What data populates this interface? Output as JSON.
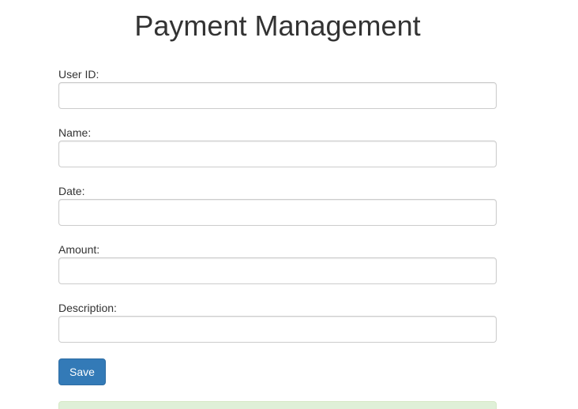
{
  "page": {
    "title": "Payment Management"
  },
  "form": {
    "fields": [
      {
        "label": "User ID:",
        "value": "",
        "placeholder": ""
      },
      {
        "label": "Name:",
        "value": "",
        "placeholder": ""
      },
      {
        "label": "Date:",
        "value": "",
        "placeholder": ""
      },
      {
        "label": "Amount:",
        "value": "",
        "placeholder": ""
      },
      {
        "label": "Description:",
        "value": "",
        "placeholder": ""
      }
    ],
    "save_label": "Save"
  },
  "theme": {
    "primary": "#337ab7",
    "success_bg": "#dff0d8",
    "text": "#333333",
    "input_border": "#cccccc"
  }
}
